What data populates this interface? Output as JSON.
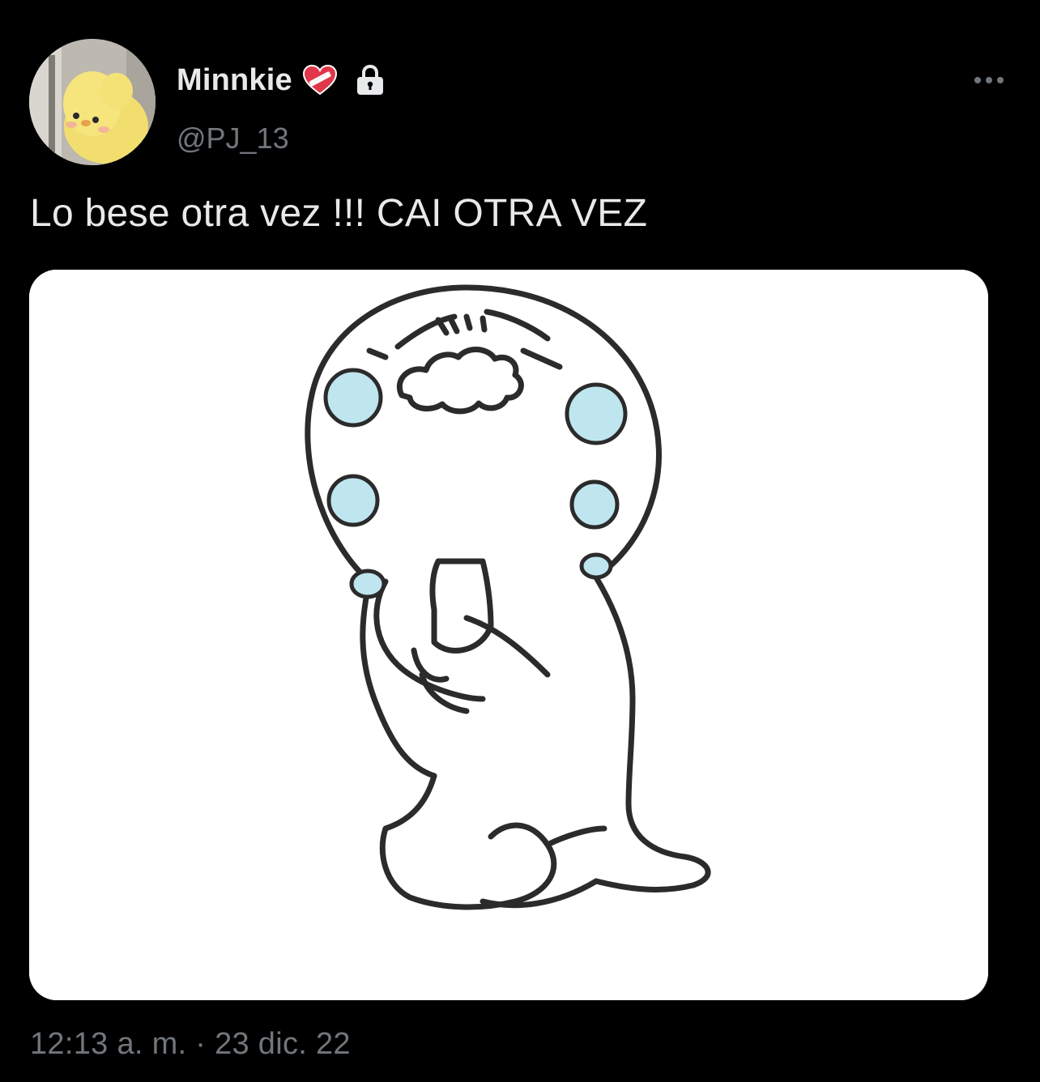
{
  "tweet": {
    "display_name": "Minnkie",
    "handle": "@PJ_13",
    "text": "Lo bese otra vez !!! CAI OTRA VEZ",
    "timestamp": "12:13 a. m. · 23 dic. 22",
    "badges": [
      "mending-heart-icon",
      "lock-icon"
    ],
    "more_icon": "more-options-icon"
  },
  "media": {
    "description_icon": "crying-kneeling-character-image"
  },
  "colors": {
    "background": "#000000",
    "primary_text": "#e7e9ea",
    "secondary_text": "#71767b",
    "tear_blue": "#bfe6ef"
  }
}
